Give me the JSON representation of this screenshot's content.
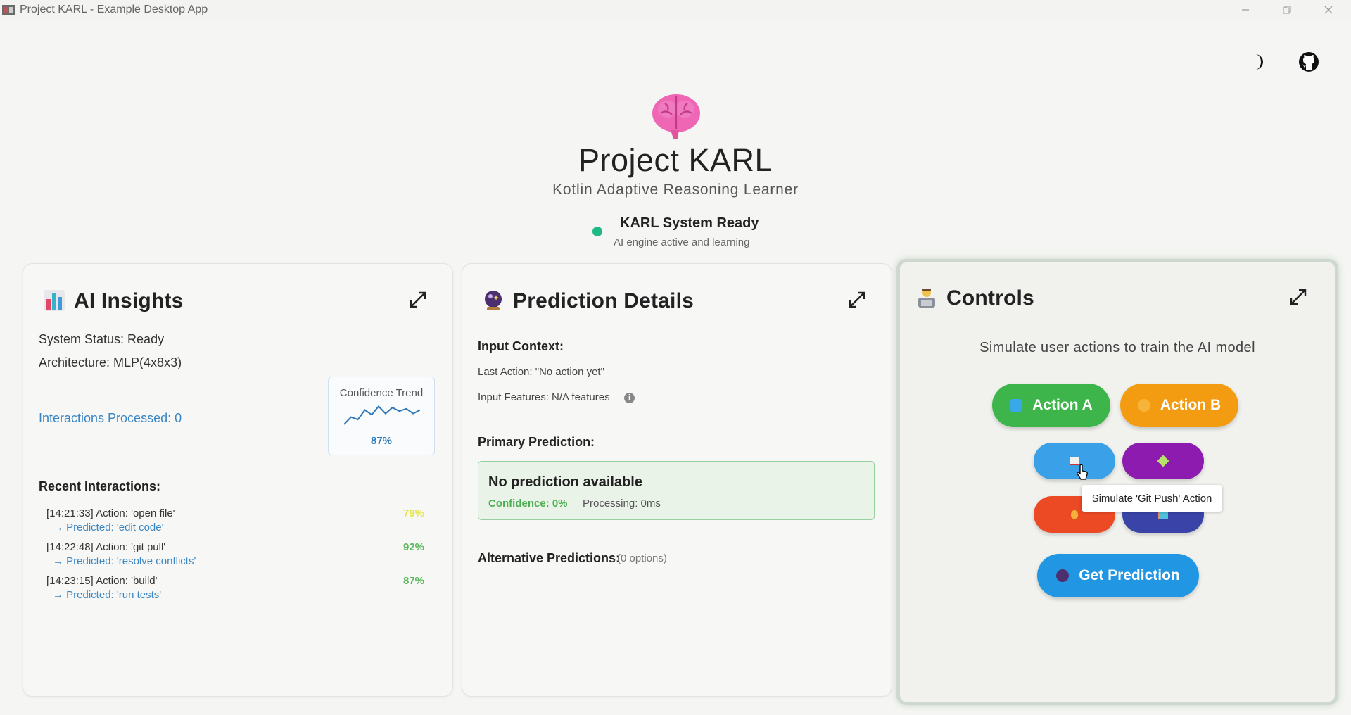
{
  "window": {
    "title": "Project KARL - Example Desktop App"
  },
  "header": {
    "title": "Project KARL",
    "subtitle": "Kotlin Adaptive Reasoning Learner",
    "status_title": "KARL System Ready",
    "status_subtitle": "AI engine active and learning"
  },
  "insights": {
    "title": "AI Insights",
    "system_status": "System Status: Ready",
    "architecture": "Architecture: MLP(4x8x3)",
    "interactions": "Interactions Processed: 0",
    "trend_label": "Confidence Trend",
    "trend_value": "87%",
    "trend_points": [
      0.15,
      0.45,
      0.35,
      0.75,
      0.55,
      0.9,
      0.6,
      0.85,
      0.7,
      0.8,
      0.6,
      0.75
    ],
    "recent_title": "Recent Interactions:",
    "recent": [
      {
        "action": "[14:21:33] Action: 'open file'",
        "pred": "→ Predicted: 'edit code'",
        "conf": "79%",
        "color": "#e6e64a"
      },
      {
        "action": "[14:22:48] Action: 'git pull'",
        "pred": "→ Predicted: 'resolve conflicts'",
        "conf": "92%",
        "color": "#5cb85c"
      },
      {
        "action": "[14:23:15] Action: 'build'",
        "pred": "→ Predicted: 'run tests'",
        "conf": "87%",
        "color": "#5cb85c"
      }
    ]
  },
  "prediction": {
    "title": "Prediction Details",
    "input_context": "Input Context:",
    "last_action": "Last Action: \"No action yet\"",
    "features": "Input Features: N/A features",
    "primary": "Primary Prediction:",
    "box_title": "No prediction available",
    "box_confidence": "Confidence: 0%",
    "box_processing": "Processing: 0ms",
    "alternatives": "Alternative Predictions:",
    "alternatives_count": "(0 options)"
  },
  "controls": {
    "title": "Controls",
    "subtitle": "Simulate user actions to train the AI model",
    "action_a": "Action A",
    "action_b": "Action B",
    "get_prediction": "Get Prediction",
    "tooltip": "Simulate 'Git Push' Action",
    "colors": {
      "a": "#3db54a",
      "b": "#f39c12",
      "blue": "#3aa0e8",
      "purple": "#8e1bb0",
      "red": "#ec4a24",
      "indigo": "#3a44a8",
      "predict": "#2196e3"
    }
  }
}
